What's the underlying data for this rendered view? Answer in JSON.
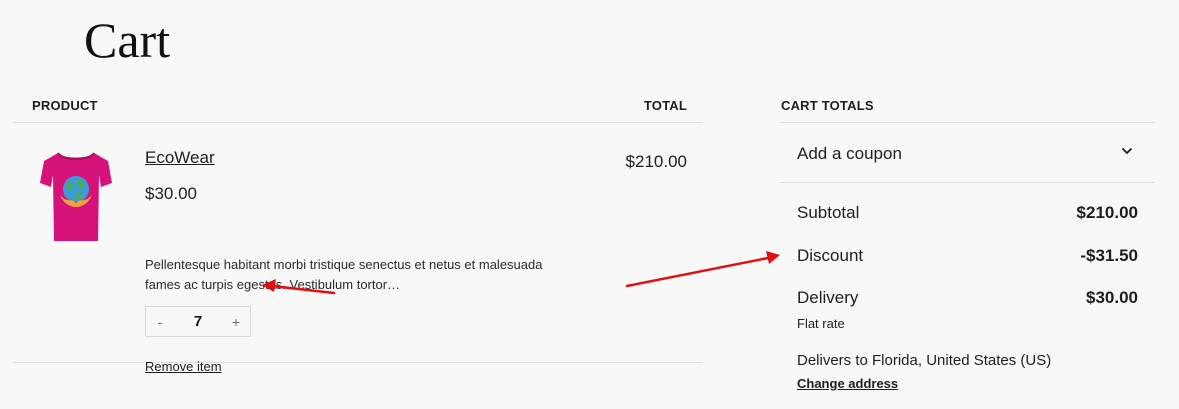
{
  "page": {
    "title": "Cart"
  },
  "table": {
    "product_header": "PRODUCT",
    "total_header": "TOTAL",
    "items": [
      {
        "name": "EcoWear",
        "price": "$30.00",
        "description": "Pellentesque habitant morbi tristique senectus et netus et malesuada fames ac turpis egestas. Vestibulum tortor…",
        "quantity": "7",
        "minus": "-",
        "plus": "+",
        "remove_label": "Remove item",
        "line_total": "$210.00",
        "image_icon": "tshirt-earth-image",
        "image_color": "#d6127a"
      }
    ]
  },
  "totals": {
    "header": "CART TOTALS",
    "coupon_label": "Add a coupon",
    "subtotal_label": "Subtotal",
    "subtotal_value": "$210.00",
    "discount_label": "Discount",
    "discount_value": "-$31.50",
    "delivery_label": "Delivery",
    "delivery_value": "$30.00",
    "delivery_method": "Flat rate",
    "delivers_to": "Delivers to Florida, United States (US)",
    "change_address": "Change address"
  },
  "annotations": {
    "arrow_color": "#e01010"
  }
}
